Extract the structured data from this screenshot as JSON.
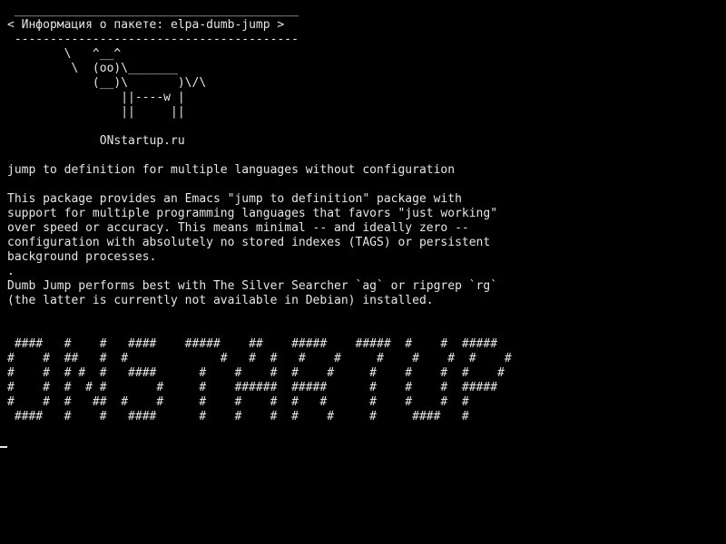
{
  "theme": {
    "background": "#000000",
    "foreground": "#e6e6e6"
  },
  "terminal": {
    "lines": [
      " ________________________________________",
      "< Информация о пакете: elpa-dumb-jump >",
      " ----------------------------------------",
      "        \\   ^__^",
      "         \\  (oo)\\_______",
      "            (__)\\       )\\/\\",
      "                ||----w |",
      "                ||     ||",
      "",
      "             ONstartup.ru",
      "",
      "jump to definition for multiple languages without configuration",
      "",
      "This package provides an Emacs \"jump to definition\" package with",
      "support for multiple programming languages that favors \"just working\"",
      "over speed or accuracy. This means minimal -- and ideally zero --",
      "configuration with absolutely no stored indexes (TAGS) or persistent",
      "background processes.",
      ".",
      "Dumb Jump performs best with The Silver Searcher `ag` or ripgrep `rg`",
      "(the latter is currently not available in Debian) installed.",
      "",
      "",
      " ####   #    #   ####    #####    ##    #####    #####  #    #  #####",
      "#    #  ##   #  #             #   #  #   #    #     #    #    #  #    #",
      "#    #  # #  #   ####      #    #    #  #    #     #    #    #  #    #",
      "#    #  #  # #       #     #    ######  #####      #    #    #  #####",
      "#    #  #   ##  #    #     #    #    #  #   #      #    #    #  #",
      " ####   #    #   ####      #    #    #  #    #     #     ####   #"
    ]
  }
}
